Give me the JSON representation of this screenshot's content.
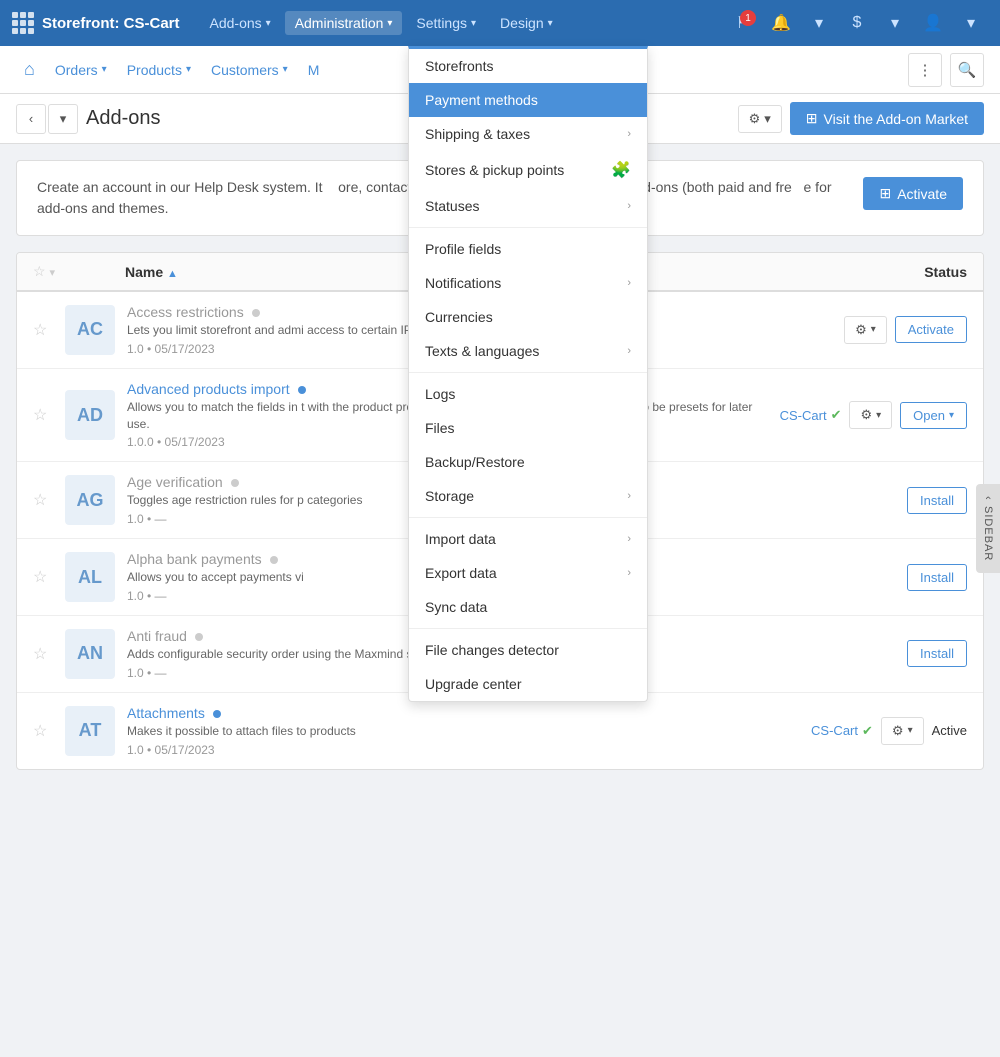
{
  "topNav": {
    "logo": "Storefront: CS-Cart",
    "items": [
      {
        "label": "Add-ons",
        "hasCaret": true
      },
      {
        "label": "Administration",
        "hasCaret": true,
        "active": true
      },
      {
        "label": "Settings",
        "hasCaret": true
      },
      {
        "label": "Design",
        "hasCaret": true
      }
    ],
    "notifBadge": "1"
  },
  "secondaryNav": {
    "items": [
      {
        "label": "Orders",
        "hasCaret": true
      },
      {
        "label": "Products",
        "hasCaret": true
      },
      {
        "label": "Customers",
        "hasCaret": true
      },
      {
        "label": "M",
        "hasCaret": false
      }
    ]
  },
  "pageHeader": {
    "title": "Add-ons",
    "gearLabel": "⚙",
    "marketButton": "Visit the Add-on Market"
  },
  "banner": {
    "text": "Create an account in our Help Desk system. It   ore, contact our Customer Care team, and get add-ons (both paid and fre   e for add-ons and themes.",
    "activateButton": "Activate"
  },
  "table": {
    "headers": {
      "name": "Name",
      "status": "Status"
    },
    "rows": [
      {
        "abbr": "AC",
        "name": "Access restrictions",
        "nameActive": false,
        "hasDot": false,
        "desc": "Lets you limit storefront and admi access to certain IP-addresses wi options",
        "version": "1.0 • 05/17/2023",
        "action": "Activate",
        "actionType": "outline",
        "hasGear": true
      },
      {
        "abbr": "AD",
        "name": "Advanced products import",
        "nameActive": true,
        "hasDot": true,
        "desc": "Allows you to match the fields in t with the product properties. These other import settings can also be presets for later use.",
        "version": "1.0.0 • 05/17/2023",
        "action": "Open",
        "actionType": "outline-caret",
        "hasGear": true,
        "vendor": "CS-Cart",
        "vendorCheck": true
      },
      {
        "abbr": "AG",
        "name": "Age verification",
        "nameActive": false,
        "hasDot": false,
        "desc": "Toggles age restriction rules for p categories",
        "version": "1.0 • —",
        "action": "Install",
        "actionType": "outline",
        "hasGear": false
      },
      {
        "abbr": "AL",
        "name": "Alpha bank payments",
        "nameActive": false,
        "hasDot": false,
        "desc": "Allows you to accept payments vi",
        "version": "1.0 • —",
        "action": "Install",
        "actionType": "outline",
        "hasGear": false
      },
      {
        "abbr": "AN",
        "name": "Anti fraud",
        "nameActive": false,
        "hasDot": false,
        "desc": "Adds configurable security order using the Maxmind service to prey",
        "version": "1.0 • —",
        "action": "Install",
        "actionType": "outline",
        "hasGear": false
      },
      {
        "abbr": "AT",
        "name": "Attachments",
        "nameActive": true,
        "hasDot": true,
        "desc": "Makes it possible to attach files to products",
        "version": "1.0 • 05/17/2023",
        "action": "Active",
        "actionType": "text",
        "hasGear": true,
        "vendor": "CS-Cart",
        "vendorCheck": true
      }
    ]
  },
  "adminDropdown": {
    "items": [
      {
        "label": "Storefronts",
        "hasArrow": false,
        "active": false,
        "hasPuzzle": false,
        "separator_after": false
      },
      {
        "label": "Payment methods",
        "hasArrow": false,
        "active": true,
        "hasPuzzle": false,
        "separator_after": false
      },
      {
        "label": "Shipping & taxes",
        "hasArrow": true,
        "active": false,
        "hasPuzzle": false,
        "separator_after": false
      },
      {
        "label": "Stores & pickup points",
        "hasArrow": false,
        "active": false,
        "hasPuzzle": true,
        "separator_after": false
      },
      {
        "label": "Statuses",
        "hasArrow": true,
        "active": false,
        "hasPuzzle": false,
        "separator_after": true
      },
      {
        "label": "Profile fields",
        "hasArrow": false,
        "active": false,
        "hasPuzzle": false,
        "separator_after": false
      },
      {
        "label": "Notifications",
        "hasArrow": true,
        "active": false,
        "hasPuzzle": false,
        "separator_after": false
      },
      {
        "label": "Currencies",
        "hasArrow": false,
        "active": false,
        "hasPuzzle": false,
        "separator_after": false
      },
      {
        "label": "Texts & languages",
        "hasArrow": true,
        "active": false,
        "hasPuzzle": false,
        "separator_after": true
      },
      {
        "label": "Logs",
        "hasArrow": false,
        "active": false,
        "hasPuzzle": false,
        "separator_after": false
      },
      {
        "label": "Files",
        "hasArrow": false,
        "active": false,
        "hasPuzzle": false,
        "separator_after": false
      },
      {
        "label": "Backup/Restore",
        "hasArrow": false,
        "active": false,
        "hasPuzzle": false,
        "separator_after": false
      },
      {
        "label": "Storage",
        "hasArrow": true,
        "active": false,
        "hasPuzzle": false,
        "separator_after": true
      },
      {
        "label": "Import data",
        "hasArrow": true,
        "active": false,
        "hasPuzzle": false,
        "separator_after": false
      },
      {
        "label": "Export data",
        "hasArrow": true,
        "active": false,
        "hasPuzzle": false,
        "separator_after": false
      },
      {
        "label": "Sync data",
        "hasArrow": false,
        "active": false,
        "hasPuzzle": false,
        "separator_after": true
      },
      {
        "label": "File changes detector",
        "hasArrow": false,
        "active": false,
        "hasPuzzle": false,
        "separator_after": false
      },
      {
        "label": "Upgrade center",
        "hasArrow": false,
        "active": false,
        "hasPuzzle": false,
        "separator_after": false
      }
    ]
  },
  "sidebar": {
    "label": "SIDEBAR"
  }
}
